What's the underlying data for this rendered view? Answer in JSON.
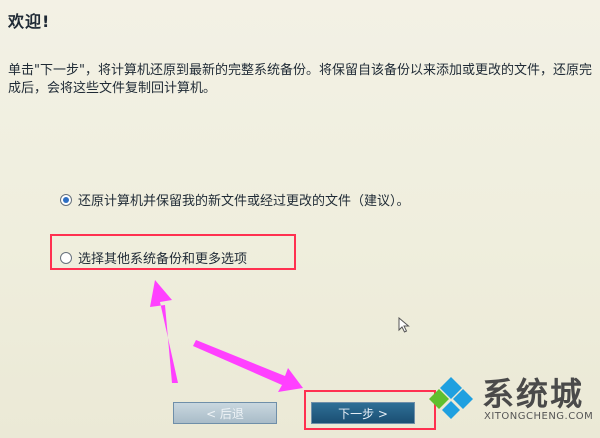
{
  "wizard": {
    "title": "欢迎!",
    "description": "单击\"下一步\"，将计算机还原到最新的完整系统备份。将保留自该备份以来添加或更改的文件，还原完成后，会将这些文件复制回计算机。",
    "options": [
      {
        "label": "还原计算机并保留我的新文件或经过更改的文件（建议）。",
        "selected": true
      },
      {
        "label": "选择其他系统备份和更多选项",
        "selected": false
      }
    ],
    "buttons": {
      "back": "< 后退",
      "next": "下一步 >"
    }
  },
  "watermark": {
    "name": "系统城",
    "domain": "XITONGCHENG.COM"
  },
  "colors": {
    "highlight": "#ff3050",
    "arrow": "#ff40ff",
    "logo_blue": "#1fa0e0",
    "logo_green": "#5fbf2f"
  }
}
